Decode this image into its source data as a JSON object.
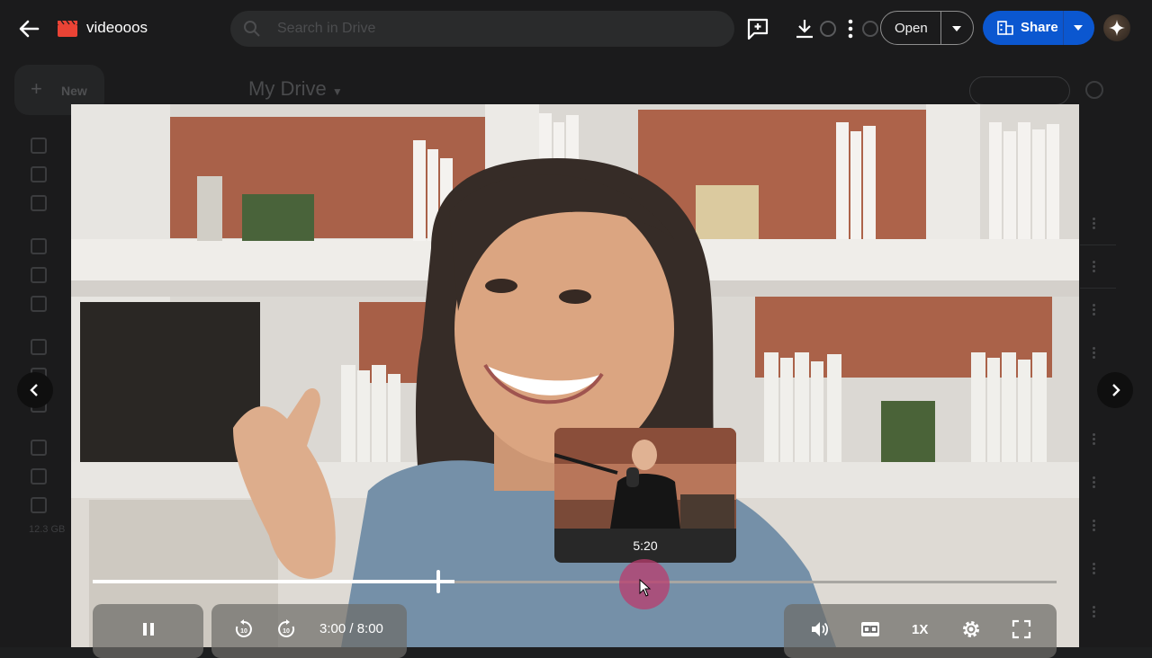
{
  "header": {
    "title": "videooos",
    "search_placeholder": "Search in Drive",
    "open_label": "Open",
    "share_label": "Share"
  },
  "background": {
    "new_label": "New",
    "my_drive_label": "My Drive",
    "storage_text": "12.3 GB"
  },
  "preview": {
    "time": "5:20"
  },
  "player": {
    "time_display": "3:00 / 8:00",
    "speed_label": "1X",
    "progress_fraction": 0.375,
    "hover_fraction": 0.5667
  },
  "icons": {
    "back": "arrow-left-icon",
    "logo": "clapperboard-icon",
    "comment": "add-comment-icon",
    "download": "download-icon",
    "more": "more-vert-icon",
    "open_caret": "caret-down-icon",
    "share": "share-people-icon",
    "gemini": "sparkle-icon",
    "prev": "chevron-left-icon",
    "next": "chevron-right-icon",
    "pause": "pause-icon",
    "rewind": "rewind-10-icon",
    "forward": "forward-10-icon",
    "volume": "volume-icon",
    "captions": "closed-captions-icon",
    "settings": "gear-icon",
    "fullscreen": "fullscreen-icon"
  },
  "colors": {
    "accent": "#0b57d0",
    "hover_marker": "#b93c6e",
    "logo_red": "#ea4335"
  }
}
